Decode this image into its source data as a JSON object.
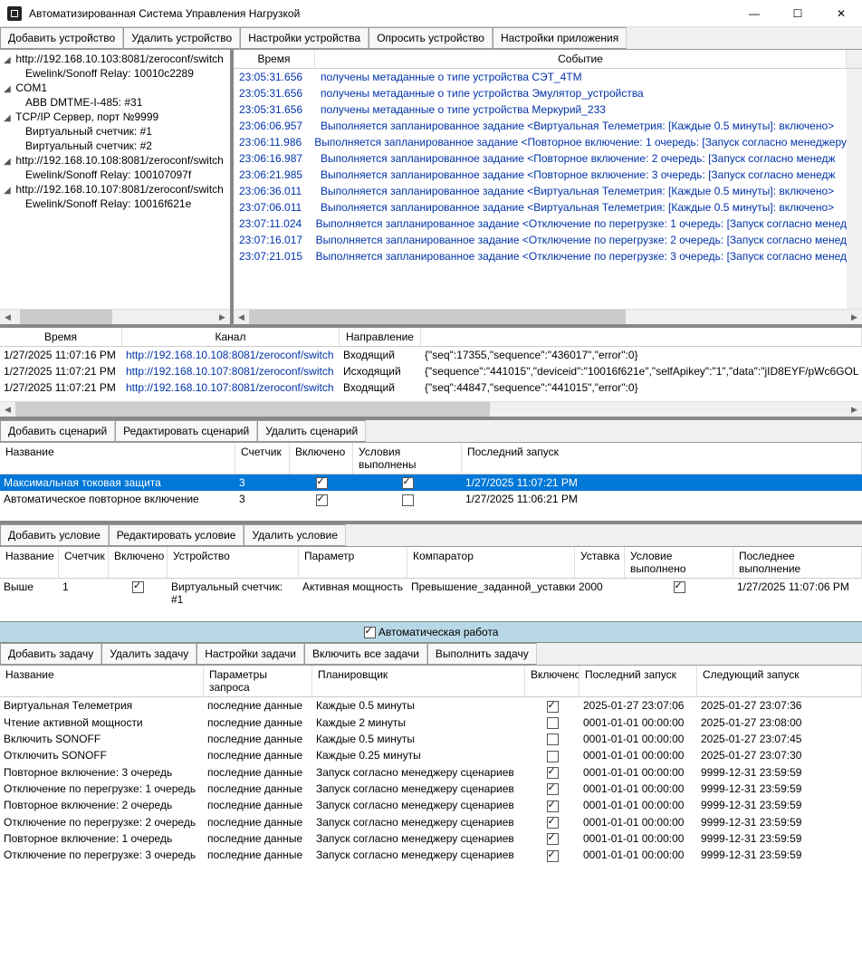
{
  "window": {
    "title": "Автоматизированная Система Управления Нагрузкой"
  },
  "main_toolbar": {
    "add_device": "Добавить устройство",
    "remove_device": "Удалить устройство",
    "device_settings": "Настройки устройства",
    "poll_device": "Опросить устройство",
    "app_settings": "Настройки приложения"
  },
  "tree": [
    {
      "label": "http://192.168.10.103:8081/zeroconf/switch",
      "level": 1,
      "expanded": true
    },
    {
      "label": "Ewelink/Sonoff Relay: 10010c2289",
      "level": 2
    },
    {
      "label": "COM1",
      "level": 1,
      "expanded": true
    },
    {
      "label": "ABB DMTME-I-485: #31",
      "level": 2
    },
    {
      "label": "TCP/IP Сервер, порт №9999",
      "level": 1,
      "expanded": true
    },
    {
      "label": "Виртуальный счетчик: #1",
      "level": 2
    },
    {
      "label": "Виртуальный счетчик: #2",
      "level": 2
    },
    {
      "label": "http://192.168.10.108:8081/zeroconf/switch",
      "level": 1,
      "expanded": true
    },
    {
      "label": "Ewelink/Sonoff Relay: 100107097f",
      "level": 2
    },
    {
      "label": "http://192.168.10.107:8081/zeroconf/switch",
      "level": 1,
      "expanded": true
    },
    {
      "label": "Ewelink/Sonoff Relay: 10016f621e",
      "level": 2
    }
  ],
  "log": {
    "headers": {
      "time": "Время",
      "event": "Событие"
    },
    "rows": [
      {
        "time": "23:05:31.656",
        "event": "получены метаданные о типе устройства СЭТ_4ТМ"
      },
      {
        "time": "23:05:31.656",
        "event": "получены метаданные о типе устройства Эмулятор_устройства"
      },
      {
        "time": "23:05:31.656",
        "event": "получены метаданные о типе устройства Меркурий_233"
      },
      {
        "time": "23:06:06.957",
        "event": "Выполняется запланированное задание <Виртуальная Телеметрия: [Каждые 0.5 минуты]: включено>"
      },
      {
        "time": "23:06:11.986",
        "event": "Выполняется запланированное задание <Повторное включение: 1 очередь: [Запуск согласно менеджеру"
      },
      {
        "time": "23:06:16.987",
        "event": "Выполняется запланированное задание <Повторное включение: 2 очередь: [Запуск согласно менедж"
      },
      {
        "time": "23:06:21.985",
        "event": "Выполняется запланированное задание <Повторное включение: 3 очередь: [Запуск согласно менедж"
      },
      {
        "time": "23:06:36.011",
        "event": "Выполняется запланированное задание <Виртуальная Телеметрия: [Каждые 0.5 минуты]: включено>"
      },
      {
        "time": "23:07:06.011",
        "event": "Выполняется запланированное задание <Виртуальная Телеметрия: [Каждые 0.5 минуты]: включено>"
      },
      {
        "time": "23:07:11.024",
        "event": "Выполняется запланированное задание <Отключение по перегрузке: 1 очередь: [Запуск согласно менед"
      },
      {
        "time": "23:07:16.017",
        "event": "Выполняется запланированное задание <Отключение по перегрузке: 2 очередь: [Запуск согласно менед"
      },
      {
        "time": "23:07:21.015",
        "event": "Выполняется запланированное задание <Отключение по перегрузке: 3 очередь: [Запуск согласно менед"
      }
    ]
  },
  "traffic": {
    "headers": {
      "time": "Время",
      "channel": "Канал",
      "direction": "Направление"
    },
    "rows": [
      {
        "time": "1/27/2025 11:07:16 PM",
        "channel": "http://192.168.10.108:8081/zeroconf/switch",
        "direction": "Входящий",
        "payload": "{\"seq\":17355,\"sequence\":\"436017\",\"error\":0}"
      },
      {
        "time": "1/27/2025 11:07:21 PM",
        "channel": "http://192.168.10.107:8081/zeroconf/switch",
        "direction": "Исходящий",
        "payload": "{\"sequence\":\"441015\",\"deviceid\":\"10016f621e\",\"selfApikey\":\"1\",\"data\":\"jID8EYF/pWc6GOL"
      },
      {
        "time": "1/27/2025 11:07:21 PM",
        "channel": "http://192.168.10.107:8081/zeroconf/switch",
        "direction": "Входящий",
        "payload": "{\"seq\":44847,\"sequence\":\"441015\",\"error\":0}"
      }
    ]
  },
  "scen_toolbar": {
    "add": "Добавить сценарий",
    "edit": "Редактировать сценарий",
    "remove": "Удалить сценарий"
  },
  "scen": {
    "headers": {
      "name": "Название",
      "counter": "Счетчик",
      "enabled": "Включено",
      "cond_met": "Условия выполнены",
      "last_run": "Последний запуск"
    },
    "rows": [
      {
        "name": "Максимальная токовая защита",
        "counter": "3",
        "enabled": true,
        "cond_met": true,
        "last_run": "1/27/2025 11:07:21 PM",
        "selected": true
      },
      {
        "name": "Автоматическое повторное включение",
        "counter": "3",
        "enabled": true,
        "cond_met": false,
        "last_run": "1/27/2025 11:06:21 PM",
        "selected": false
      }
    ]
  },
  "cond_toolbar": {
    "add": "Добавить условие",
    "edit": "Редактировать условие",
    "remove": "Удалить условие"
  },
  "cond": {
    "headers": {
      "name": "Название",
      "counter": "Счетчик",
      "enabled": "Включено",
      "device": "Устройство",
      "param": "Параметр",
      "comparator": "Компаратор",
      "setpoint": "Уставка",
      "cond_met": "Условие выполнено",
      "last_exec": "Последнее выполнение"
    },
    "rows": [
      {
        "name": "Выше",
        "counter": "1",
        "enabled": true,
        "device": "Виртуальный счетчик: #1",
        "param": "Активная мощность",
        "comparator": "Превышение_заданной_уставки",
        "setpoint": "2000",
        "cond_met": true,
        "last_exec": "1/27/2025 11:07:06 PM"
      }
    ]
  },
  "auto_mode": {
    "label": "Автоматическая работа",
    "checked": true
  },
  "task_toolbar": {
    "add": "Добавить задачу",
    "remove": "Удалить задачу",
    "settings": "Настройки задачи",
    "enable_all": "Включить все задачи",
    "run": "Выполнить задачу"
  },
  "task": {
    "headers": {
      "name": "Название",
      "params": "Параметры запроса",
      "sched": "Планировщик",
      "enabled": "Включено",
      "last_run": "Последний запуск",
      "next_run": "Следующий запуск"
    },
    "rows": [
      {
        "name": "Виртуальная Телеметрия",
        "params": "последние данные",
        "sched": "Каждые 0.5 минуты",
        "enabled": true,
        "last_run": "2025-01-27 23:07:06",
        "next_run": "2025-01-27 23:07:36"
      },
      {
        "name": "Чтение активной мощности",
        "params": "последние данные",
        "sched": "Каждые 2 минуты",
        "enabled": false,
        "last_run": "0001-01-01 00:00:00",
        "next_run": "2025-01-27 23:08:00"
      },
      {
        "name": "Включить SONOFF",
        "params": "последние данные",
        "sched": "Каждые 0.5 минуты",
        "enabled": false,
        "last_run": "0001-01-01 00:00:00",
        "next_run": "2025-01-27 23:07:45"
      },
      {
        "name": "Отключить SONOFF",
        "params": "последние данные",
        "sched": "Каждые 0.25 минуты",
        "enabled": false,
        "last_run": "0001-01-01 00:00:00",
        "next_run": "2025-01-27 23:07:30"
      },
      {
        "name": "Повторное включение: 3 очередь",
        "params": "последние данные",
        "sched": "Запуск согласно менеджеру сценариев",
        "enabled": true,
        "last_run": "0001-01-01 00:00:00",
        "next_run": "9999-12-31 23:59:59"
      },
      {
        "name": "Отключение по перегрузке: 1 очередь",
        "params": "последние данные",
        "sched": "Запуск согласно менеджеру сценариев",
        "enabled": true,
        "last_run": "0001-01-01 00:00:00",
        "next_run": "9999-12-31 23:59:59"
      },
      {
        "name": "Повторное включение: 2 очередь",
        "params": "последние данные",
        "sched": "Запуск согласно менеджеру сценариев",
        "enabled": true,
        "last_run": "0001-01-01 00:00:00",
        "next_run": "9999-12-31 23:59:59"
      },
      {
        "name": "Отключение по перегрузке: 2 очередь",
        "params": "последние данные",
        "sched": "Запуск согласно менеджеру сценариев",
        "enabled": true,
        "last_run": "0001-01-01 00:00:00",
        "next_run": "9999-12-31 23:59:59"
      },
      {
        "name": "Повторное включение: 1 очередь",
        "params": "последние данные",
        "sched": "Запуск согласно менеджеру сценариев",
        "enabled": true,
        "last_run": "0001-01-01 00:00:00",
        "next_run": "9999-12-31 23:59:59"
      },
      {
        "name": "Отключение по перегрузке: 3 очередь",
        "params": "последние данные",
        "sched": "Запуск согласно менеджеру сценариев",
        "enabled": true,
        "last_run": "0001-01-01 00:00:00",
        "next_run": "9999-12-31 23:59:59"
      }
    ]
  }
}
